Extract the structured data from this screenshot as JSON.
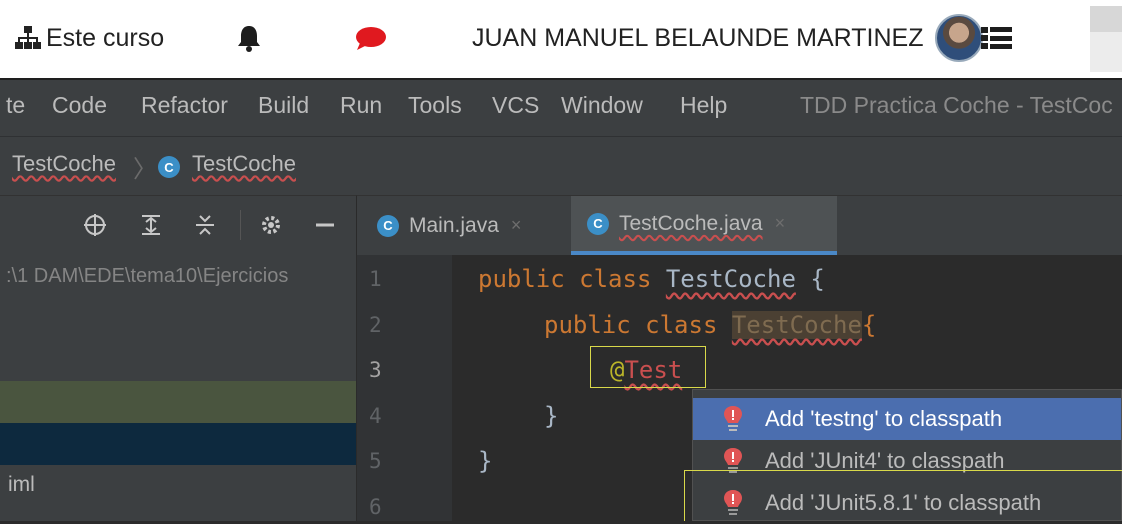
{
  "moodle": {
    "course_label": "Este curso",
    "user_name": "JUAN MANUEL BELAUNDE MARTINEZ",
    "icons": [
      "sitemap-icon",
      "bell-icon",
      "chat-icon",
      "avatar",
      "user-list-icon"
    ]
  },
  "menu": {
    "items": [
      "te",
      "Code",
      "Refactor",
      "Build",
      "Run",
      "Tools",
      "VCS",
      "Window",
      "Help"
    ],
    "window_title": "TDD Practica Coche - TestCoc"
  },
  "breadcrumb": {
    "items": [
      "TestCoche",
      "TestCoche"
    ],
    "class_icon_letter": "C"
  },
  "project": {
    "toolbar_icons": [
      "locate-icon",
      "expand-all-icon",
      "collapse-all-icon",
      "gear-icon",
      "minimize-icon"
    ],
    "path": ":\\1 DAM\\EDE\\tema10\\Ejercicios",
    "file_iml": "iml"
  },
  "tabs": [
    {
      "label": "Main.java",
      "close": "×",
      "active": false
    },
    {
      "label": "TestCoche.java",
      "close": "×",
      "active": true
    }
  ],
  "editor": {
    "line_numbers": [
      "1",
      "2",
      "3",
      "4",
      "5",
      "6"
    ],
    "lines": {
      "l1_kw1": "public",
      "l1_kw2": "class",
      "l1_name": "TestCoche",
      "l1_brace": " {",
      "l2_kw1": "public",
      "l2_kw2": "class",
      "l2_name": "TestCoche",
      "l2_brace": "{",
      "l3_at": "@",
      "l3_name": "Test",
      "l4": "}",
      "l5": "}"
    }
  },
  "intentions": [
    {
      "label": "Add 'testng' to classpath",
      "selected": true
    },
    {
      "label": "Add 'JUnit4' to classpath",
      "selected": false
    },
    {
      "label": "Add 'JUnit5.8.1' to classpath",
      "selected": false
    }
  ],
  "colors": {
    "keyword": "#cc7832",
    "annotation": "#bbb529",
    "error": "#c94f4f",
    "selection": "#4b6eaf",
    "class_icon": "#3b8fc7"
  }
}
